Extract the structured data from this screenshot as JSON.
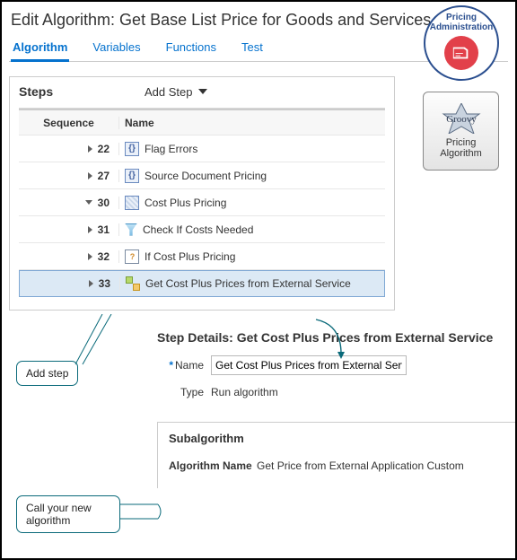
{
  "header": {
    "title": "Edit Algorithm: Get Base List Price for Goods and Services"
  },
  "tabs": [
    "Algorithm",
    "Variables",
    "Functions",
    "Test"
  ],
  "steps": {
    "title": "Steps",
    "add_label": "Add Step",
    "columns": {
      "seq": "Sequence",
      "name": "Name"
    },
    "rows": [
      {
        "seq": "22",
        "name": "Flag Errors",
        "icon": "box",
        "indent": 0,
        "exp": "r"
      },
      {
        "seq": "27",
        "name": "Source Document Pricing",
        "icon": "box",
        "indent": 0,
        "exp": "r"
      },
      {
        "seq": "30",
        "name": "Cost Plus Pricing",
        "icon": "pat",
        "indent": 0,
        "exp": "d"
      },
      {
        "seq": "31",
        "name": "Check If Costs Needed",
        "icon": "funnel",
        "indent": 1,
        "exp": "r"
      },
      {
        "seq": "32",
        "name": "If Cost Plus Pricing",
        "icon": "doc",
        "indent": 1,
        "exp": "r"
      },
      {
        "seq": "33",
        "name": "Get Cost Plus Prices from External Service",
        "icon": "flow",
        "indent": 1,
        "exp": "r",
        "selected": true
      }
    ]
  },
  "details": {
    "heading": "Step Details: Get Cost Plus Prices from External Service",
    "name_label": "Name",
    "name_value": "Get Cost Plus Prices from External Service",
    "type_label": "Type",
    "type_value": "Run algorithm"
  },
  "subalg": {
    "heading": "Subalgorithm",
    "name_label": "Algorithm Name",
    "name_value": "Get Price from External Application Custom"
  },
  "badges": {
    "admin": "Pricing Administration",
    "alg_l1": "Pricing",
    "alg_l2": "Algorithm"
  },
  "callouts": {
    "addstep": "Add step",
    "callnew": "Call your new algorithm"
  }
}
